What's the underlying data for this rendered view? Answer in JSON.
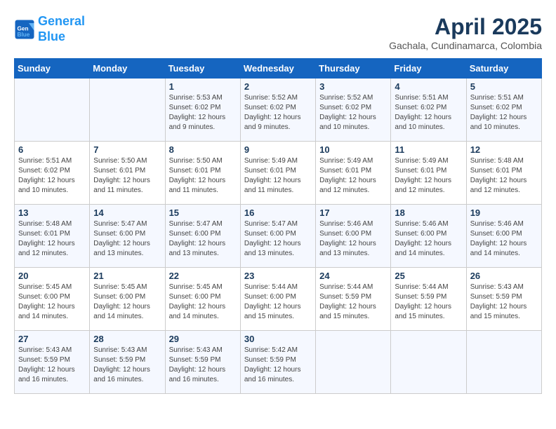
{
  "header": {
    "logo_line1": "General",
    "logo_line2": "Blue",
    "month_year": "April 2025",
    "location": "Gachala, Cundinamarca, Colombia"
  },
  "weekdays": [
    "Sunday",
    "Monday",
    "Tuesday",
    "Wednesday",
    "Thursday",
    "Friday",
    "Saturday"
  ],
  "weeks": [
    [
      {
        "day": "",
        "info": ""
      },
      {
        "day": "",
        "info": ""
      },
      {
        "day": "1",
        "info": "Sunrise: 5:53 AM\nSunset: 6:02 PM\nDaylight: 12 hours and 9 minutes."
      },
      {
        "day": "2",
        "info": "Sunrise: 5:52 AM\nSunset: 6:02 PM\nDaylight: 12 hours and 9 minutes."
      },
      {
        "day": "3",
        "info": "Sunrise: 5:52 AM\nSunset: 6:02 PM\nDaylight: 12 hours and 10 minutes."
      },
      {
        "day": "4",
        "info": "Sunrise: 5:51 AM\nSunset: 6:02 PM\nDaylight: 12 hours and 10 minutes."
      },
      {
        "day": "5",
        "info": "Sunrise: 5:51 AM\nSunset: 6:02 PM\nDaylight: 12 hours and 10 minutes."
      }
    ],
    [
      {
        "day": "6",
        "info": "Sunrise: 5:51 AM\nSunset: 6:02 PM\nDaylight: 12 hours and 10 minutes."
      },
      {
        "day": "7",
        "info": "Sunrise: 5:50 AM\nSunset: 6:01 PM\nDaylight: 12 hours and 11 minutes."
      },
      {
        "day": "8",
        "info": "Sunrise: 5:50 AM\nSunset: 6:01 PM\nDaylight: 12 hours and 11 minutes."
      },
      {
        "day": "9",
        "info": "Sunrise: 5:49 AM\nSunset: 6:01 PM\nDaylight: 12 hours and 11 minutes."
      },
      {
        "day": "10",
        "info": "Sunrise: 5:49 AM\nSunset: 6:01 PM\nDaylight: 12 hours and 12 minutes."
      },
      {
        "day": "11",
        "info": "Sunrise: 5:49 AM\nSunset: 6:01 PM\nDaylight: 12 hours and 12 minutes."
      },
      {
        "day": "12",
        "info": "Sunrise: 5:48 AM\nSunset: 6:01 PM\nDaylight: 12 hours and 12 minutes."
      }
    ],
    [
      {
        "day": "13",
        "info": "Sunrise: 5:48 AM\nSunset: 6:01 PM\nDaylight: 12 hours and 12 minutes."
      },
      {
        "day": "14",
        "info": "Sunrise: 5:47 AM\nSunset: 6:00 PM\nDaylight: 12 hours and 13 minutes."
      },
      {
        "day": "15",
        "info": "Sunrise: 5:47 AM\nSunset: 6:00 PM\nDaylight: 12 hours and 13 minutes."
      },
      {
        "day": "16",
        "info": "Sunrise: 5:47 AM\nSunset: 6:00 PM\nDaylight: 12 hours and 13 minutes."
      },
      {
        "day": "17",
        "info": "Sunrise: 5:46 AM\nSunset: 6:00 PM\nDaylight: 12 hours and 13 minutes."
      },
      {
        "day": "18",
        "info": "Sunrise: 5:46 AM\nSunset: 6:00 PM\nDaylight: 12 hours and 14 minutes."
      },
      {
        "day": "19",
        "info": "Sunrise: 5:46 AM\nSunset: 6:00 PM\nDaylight: 12 hours and 14 minutes."
      }
    ],
    [
      {
        "day": "20",
        "info": "Sunrise: 5:45 AM\nSunset: 6:00 PM\nDaylight: 12 hours and 14 minutes."
      },
      {
        "day": "21",
        "info": "Sunrise: 5:45 AM\nSunset: 6:00 PM\nDaylight: 12 hours and 14 minutes."
      },
      {
        "day": "22",
        "info": "Sunrise: 5:45 AM\nSunset: 6:00 PM\nDaylight: 12 hours and 14 minutes."
      },
      {
        "day": "23",
        "info": "Sunrise: 5:44 AM\nSunset: 6:00 PM\nDaylight: 12 hours and 15 minutes."
      },
      {
        "day": "24",
        "info": "Sunrise: 5:44 AM\nSunset: 5:59 PM\nDaylight: 12 hours and 15 minutes."
      },
      {
        "day": "25",
        "info": "Sunrise: 5:44 AM\nSunset: 5:59 PM\nDaylight: 12 hours and 15 minutes."
      },
      {
        "day": "26",
        "info": "Sunrise: 5:43 AM\nSunset: 5:59 PM\nDaylight: 12 hours and 15 minutes."
      }
    ],
    [
      {
        "day": "27",
        "info": "Sunrise: 5:43 AM\nSunset: 5:59 PM\nDaylight: 12 hours and 16 minutes."
      },
      {
        "day": "28",
        "info": "Sunrise: 5:43 AM\nSunset: 5:59 PM\nDaylight: 12 hours and 16 minutes."
      },
      {
        "day": "29",
        "info": "Sunrise: 5:43 AM\nSunset: 5:59 PM\nDaylight: 12 hours and 16 minutes."
      },
      {
        "day": "30",
        "info": "Sunrise: 5:42 AM\nSunset: 5:59 PM\nDaylight: 12 hours and 16 minutes."
      },
      {
        "day": "",
        "info": ""
      },
      {
        "day": "",
        "info": ""
      },
      {
        "day": "",
        "info": ""
      }
    ]
  ]
}
